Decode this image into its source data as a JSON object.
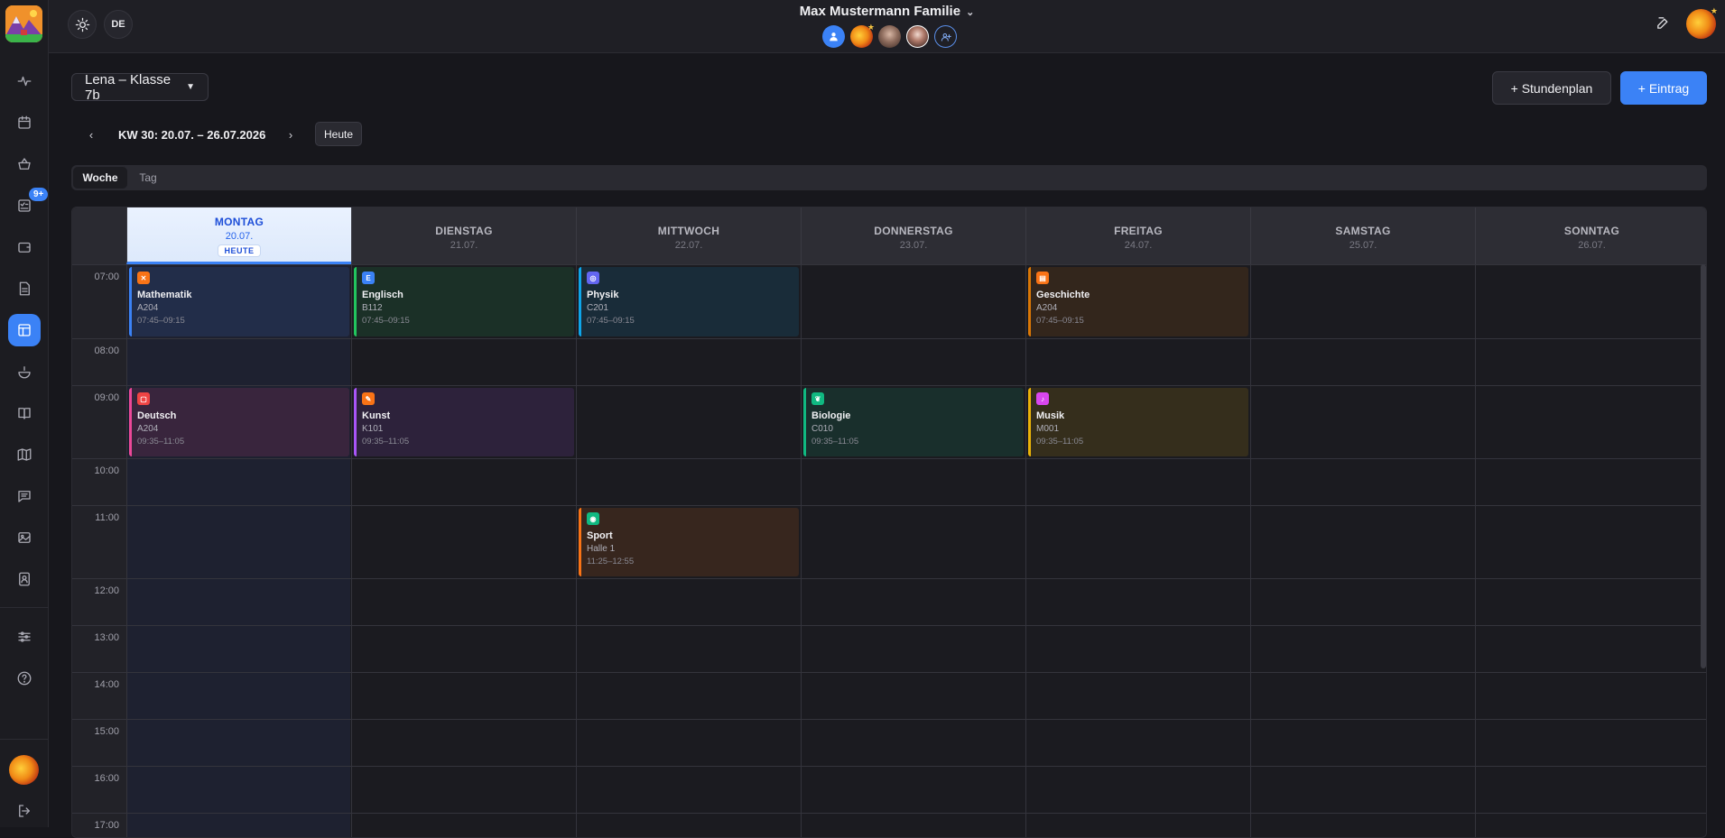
{
  "header": {
    "family_name": "Max Mustermann Familie",
    "language": "DE"
  },
  "sidebar": {
    "badge": "9+",
    "icons": [
      "activity-icon",
      "calendar-icon",
      "basket-icon",
      "checklist-icon",
      "wallet-icon",
      "document-icon",
      "timetable-icon",
      "meal-icon",
      "book-icon",
      "map-icon",
      "chat-icon",
      "image-icon",
      "contacts-icon",
      "settings-icon",
      "help-icon"
    ]
  },
  "toolbar": {
    "class_select": "Lena – Klasse 7b",
    "stundenplan_button": "+ Stundenplan",
    "eintrag_button": "+ Eintrag",
    "prev": "‹",
    "next": "›",
    "week_label": "KW 30: 20.07. – 26.07.2026",
    "today_button": "Heute"
  },
  "view_tabs": {
    "week": "Woche",
    "day": "Tag"
  },
  "days": [
    {
      "name": "MONTAG",
      "date": "20.07.",
      "today_label": "HEUTE"
    },
    {
      "name": "DIENSTAG",
      "date": "21.07."
    },
    {
      "name": "MITTWOCH",
      "date": "22.07."
    },
    {
      "name": "DONNERSTAG",
      "date": "23.07."
    },
    {
      "name": "FREITAG",
      "date": "24.07."
    },
    {
      "name": "SAMSTAG",
      "date": "25.07."
    },
    {
      "name": "SONNTAG",
      "date": "26.07."
    }
  ],
  "hours": [
    "07:00",
    "08:00",
    "09:00",
    "10:00",
    "11:00",
    "12:00",
    "13:00",
    "14:00",
    "15:00",
    "16:00",
    "17:00"
  ],
  "events": [
    {
      "title": "Mathematik",
      "room": "A204",
      "time": "07:45–09:15",
      "color": "#3b82f6",
      "icon_color": "#f97316"
    },
    {
      "title": "Englisch",
      "room": "B112",
      "time": "07:45–09:15",
      "color": "#22c55e",
      "icon_color": "#3b82f6"
    },
    {
      "title": "Physik",
      "room": "C201",
      "time": "07:45–09:15",
      "color": "#0ea5e9",
      "icon_color": "#6366f1"
    },
    {
      "title": "Geschichte",
      "room": "A204",
      "time": "07:45–09:15",
      "color": "#d97706",
      "icon_color": "#f97316"
    },
    {
      "title": "Deutsch",
      "room": "A204",
      "time": "09:35–11:05",
      "color": "#ec4899",
      "icon_color": "#ef4444"
    },
    {
      "title": "Kunst",
      "room": "K101",
      "time": "09:35–11:05",
      "color": "#a855f7",
      "icon_color": "#f97316"
    },
    {
      "title": "Biologie",
      "room": "C010",
      "time": "09:35–11:05",
      "color": "#10b981",
      "icon_color": "#10b981"
    },
    {
      "title": "Musik",
      "room": "M001",
      "time": "09:35–11:05",
      "color": "#eab308",
      "icon_color": "#d946ef"
    },
    {
      "title": "Sport",
      "room": "Halle 1",
      "time": "11:25–12:55",
      "color": "#f97316",
      "icon_color": "#10b981"
    }
  ]
}
